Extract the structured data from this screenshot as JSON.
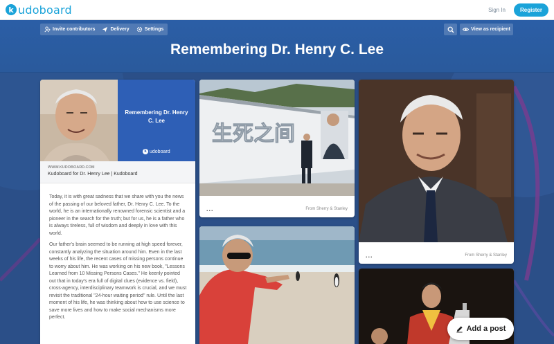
{
  "nav": {
    "logo_letter": "k",
    "logo_text": "udoboard",
    "signin": "Sign In",
    "register": "Register"
  },
  "toolbar": {
    "invite": "Invite contributors",
    "delivery": "Delivery",
    "settings": "Settings",
    "view_as_recipient": "View as recipient"
  },
  "board": {
    "title": "Remembering Dr. Henry C. Lee"
  },
  "link_card": {
    "preview_title": "Remembering Dr. Henry C. Lee",
    "preview_logo": "udoboard",
    "url": "WWW.KUDOBOARD.COM",
    "name": "Kudoboard for Dr. Henry Lee | Kudoboard",
    "paragraphs": [
      "Today, it is with great sadness that we share with you the news of the passing of our beloved father, Dr. Henry C. Lee. To the world, he is an internationally renowned forensic scientist and a pioneer in the search for the truth; but for us, he is a father who is always tireless, full of wisdom and deeply in love with this world.",
      "Our father's brain seemed to be running at high speed forever, constantly analyzing the situation around him. Even in the last weeks of his life, the recent cases of missing persons continue to worry about him. He was working on his new book, \"Lessons Learned from 10 Missing Persons Cases.\" He keenly pointed out that in today's era full of digital clues (evidence vs. field), cross-agency, interdisciplinary teamwork is crucial, and we must revisit the traditional \"24-hour waiting period\" rule. Until the last moment of his life, he was thinking about how to use science to save more lives and how to make social mechanisms more perfect."
    ]
  },
  "post_banner": {
    "banner_text": "生死之间",
    "from": "From Sherry & Stanley",
    "more": "..."
  },
  "post_portrait": {
    "from": "From Sherry & Stanley",
    "more": "..."
  },
  "add_post": "Add a post",
  "colors": {
    "brand": "#1aa3d9",
    "header": "#2b5ea6",
    "preview_blue": "#2e5fb6"
  }
}
